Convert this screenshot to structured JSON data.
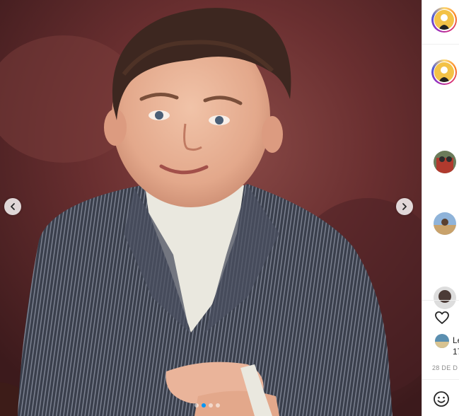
{
  "post": {
    "likes_by_prefix": "Le",
    "likes_count_prefix": "17",
    "date": "28 DE D"
  },
  "carousel": {
    "total": 4,
    "active_index": 1
  },
  "colors": {
    "accent": "#0095f6",
    "border": "#dbdbdb"
  },
  "icons": {
    "prev": "chevron-left-icon",
    "next": "chevron-right-icon",
    "like": "heart-icon",
    "emoji": "emoji-icon"
  }
}
